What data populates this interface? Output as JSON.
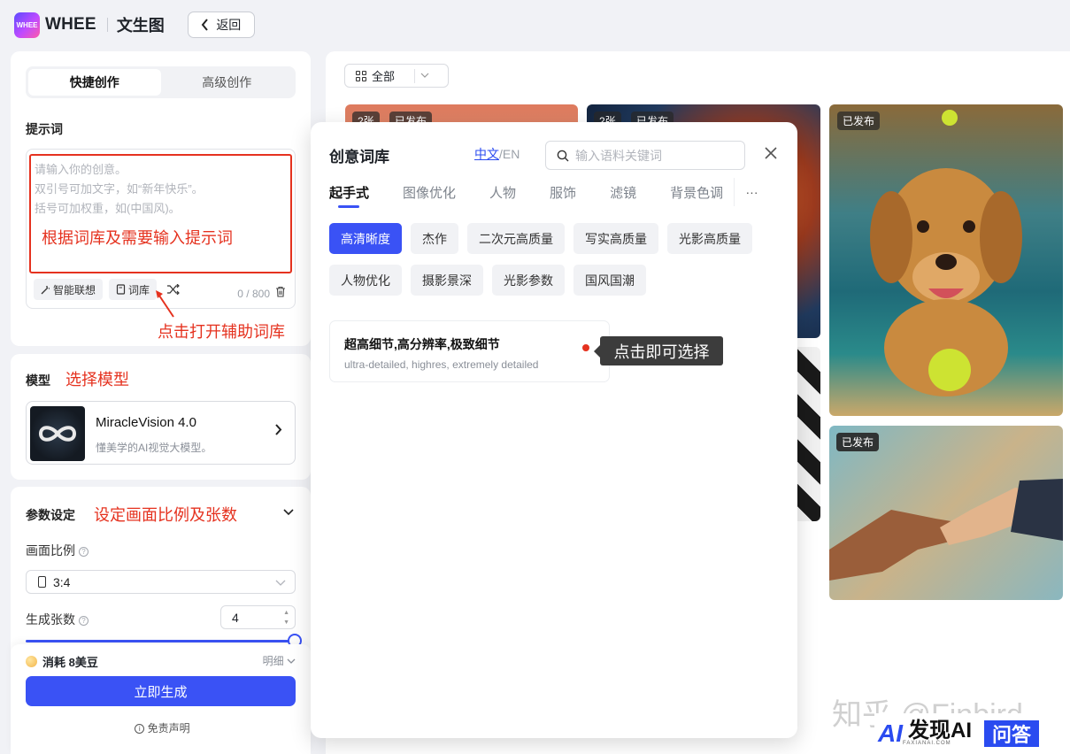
{
  "header": {
    "logo_mark": "WHEE",
    "logo_text": "WHEE",
    "page_title": "文生图",
    "back_label": "返回"
  },
  "left": {
    "mode_tabs": [
      {
        "label": "快捷创作",
        "active": true
      },
      {
        "label": "高级创作",
        "active": false
      }
    ],
    "prompt_label": "提示词",
    "prompt_placeholder": [
      "请输入你的创意。",
      "双引号可加文字，如“新年快乐”。",
      "括号可加权重，如(中国风)。"
    ],
    "prompt_annotation": "根据词库及需要输入提示词",
    "tools": {
      "smart": "智能联想",
      "library": "词库"
    },
    "counter": "0 / 800",
    "library_annotation": "点击打开辅助词库",
    "model_label": "模型",
    "model_annotation": "选择模型",
    "model_name": "MiracleVision 4.0",
    "model_desc": "懂美学的AI视觉大模型。",
    "params_label": "参数设定",
    "params_annotation": "设定画面比例及张数",
    "ratio_label": "画面比例",
    "ratio_value": "3:4",
    "count_label": "生成张数",
    "count_value": "4",
    "slider_level": 1.0,
    "cost_label": "消耗 8美豆",
    "detail_label": "明细",
    "generate_label": "立即生成",
    "disclaimer": "免责声明"
  },
  "gallery": {
    "filter_label": "全部",
    "badges": {
      "count": "2张",
      "published": "已发布"
    }
  },
  "popup": {
    "title": "创意词库",
    "lang_zh": "中文",
    "lang_sep": "/",
    "lang_en": "EN",
    "search_placeholder": "输入语料关键词",
    "categories": [
      "起手式",
      "图像优化",
      "人物",
      "服饰",
      "滤镜",
      "背景色调"
    ],
    "more": "···",
    "chips": [
      "高清晰度",
      "杰作",
      "二次元高质量",
      "写实高质量",
      "光影高质量",
      "人物优化",
      "摄影景深",
      "光影参数",
      "国风国潮"
    ],
    "term_zh": "超高细节,高分辨率,极致细节",
    "term_en": "ultra-detailed, highres, extremely detailed",
    "tooltip": "点击即可选择"
  },
  "overlay": {
    "watermark": "知乎 @Finbird",
    "brand_ai": "AI",
    "brand_cn": "发现AI",
    "brand_sub": "FAXIANAI.COM",
    "brand_qa": "问答"
  },
  "colors": {
    "accent": "#3a52f5",
    "annotation": "#e5321f"
  }
}
